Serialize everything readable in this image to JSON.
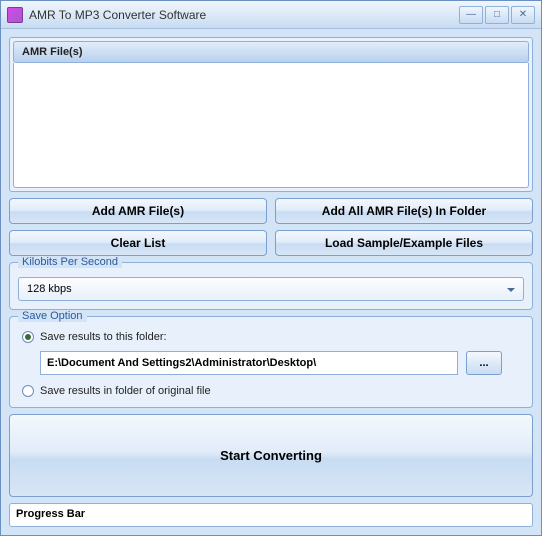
{
  "window": {
    "title": "AMR To MP3 Converter Software"
  },
  "fileList": {
    "header": "AMR File(s)"
  },
  "buttons": {
    "addFiles": "Add AMR File(s)",
    "addFolder": "Add All AMR File(s) In Folder",
    "clearList": "Clear List",
    "loadSample": "Load Sample/Example Files",
    "start": "Start Converting",
    "browse": "..."
  },
  "kilobits": {
    "groupLabel": "Kilobits Per Second",
    "selected": "128 kbps"
  },
  "saveOption": {
    "groupLabel": "Save Option",
    "radio1": "Save results to this folder:",
    "radio2": "Save results in folder of original file",
    "path": "E:\\Document And Settings2\\Administrator\\Desktop\\"
  },
  "progress": {
    "label": "Progress Bar"
  }
}
